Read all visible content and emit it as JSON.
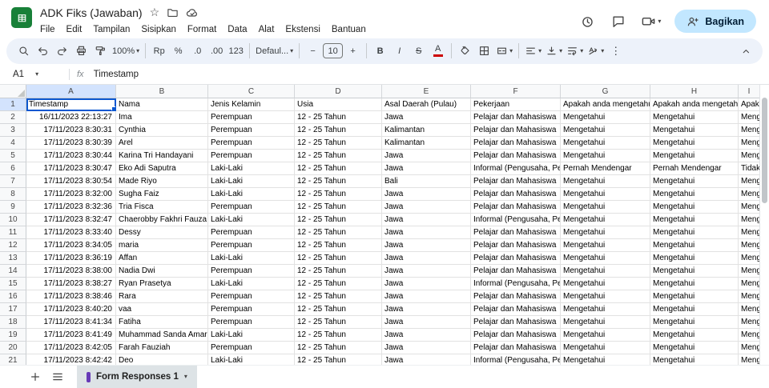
{
  "header": {
    "title": "ADK Fiks (Jawaban)",
    "menu_items": [
      "File",
      "Edit",
      "Tampilan",
      "Sisipkan",
      "Format",
      "Data",
      "Alat",
      "Ekstensi",
      "Bantuan"
    ],
    "share_label": "Bagikan"
  },
  "toolbar": {
    "zoom_value": "100%",
    "currency_label": "Rp",
    "percent_label": "%",
    "decimal_decrease_label": ".0",
    "decimal_increase_label": ".00",
    "number_format_label": "123",
    "font_name": "Defaul...",
    "font_size_value": "10",
    "bold_label": "B",
    "italic_label": "I",
    "strikethrough_label": "S",
    "text_color_label": "A",
    "more_label": "⋮"
  },
  "formula_bar": {
    "cell_reference": "A1",
    "fx_label": "fx",
    "value": "Timestamp"
  },
  "grid": {
    "column_letters": [
      "A",
      "B",
      "C",
      "D",
      "E",
      "F",
      "G",
      "H",
      "I"
    ],
    "header_row": [
      "Timestamp",
      "Nama",
      "Jenis Kelamin",
      "Usia",
      "Asal Daerah (Pulau)",
      "Pekerjaan",
      "Apakah anda mengetahu",
      "Apakah anda mengetahu",
      "Apakah"
    ],
    "data_rows": [
      [
        "16/11/2023 22:13:27",
        "Ima",
        "Perempuan",
        "12 - 25 Tahun",
        "Jawa",
        "Pelajar dan Mahasiswa",
        "Mengetahui",
        "Mengetahui",
        "Mengetahui"
      ],
      [
        "17/11/2023 8:30:31",
        "Cynthia",
        "Perempuan",
        "12 - 25 Tahun",
        "Kalimantan",
        "Pelajar dan Mahasiswa",
        "Mengetahui",
        "Mengetahui",
        "Mengetahui"
      ],
      [
        "17/11/2023 8:30:39",
        "Arel",
        "Perempuan",
        "12 - 25 Tahun",
        "Kalimantan",
        "Pelajar dan Mahasiswa",
        "Mengetahui",
        "Mengetahui",
        "Mengetahui"
      ],
      [
        "17/11/2023 8:30:44",
        "Karina Tri Handayani",
        "Perempuan",
        "12 - 25 Tahun",
        "Jawa",
        "Pelajar dan Mahasiswa",
        "Mengetahui",
        "Mengetahui",
        "Mengetahui"
      ],
      [
        "17/11/2023 8:30:47",
        "Eko Adi Saputra",
        "Laki-Laki",
        "12 - 25 Tahun",
        "Jawa",
        "Informal (Pengusaha, Pe",
        "Pernah Mendengar",
        "Pernah Mendengar",
        "Tidak M"
      ],
      [
        "17/11/2023 8:30:54",
        "Made Riyo",
        "Laki-Laki",
        "12 - 25 Tahun",
        "Bali",
        "Pelajar dan Mahasiswa",
        "Mengetahui",
        "Mengetahui",
        "Mengetahui"
      ],
      [
        "17/11/2023 8:32:00",
        "Sugha Faiz",
        "Laki-Laki",
        "12 - 25 Tahun",
        "Jawa",
        "Pelajar dan Mahasiswa",
        "Mengetahui",
        "Mengetahui",
        "Mengetahui"
      ],
      [
        "17/11/2023 8:32:36",
        "Tria Fisca",
        "Perempuan",
        "12 - 25 Tahun",
        "Jawa",
        "Pelajar dan Mahasiswa",
        "Mengetahui",
        "Mengetahui",
        "Mengetahui"
      ],
      [
        "17/11/2023 8:32:47",
        "Chaerobby Fakhri Fauza",
        "Laki-Laki",
        "12 - 25 Tahun",
        "Jawa",
        "Informal (Pengusaha, Pe",
        "Mengetahui",
        "Mengetahui",
        "Mengetahui"
      ],
      [
        "17/11/2023 8:33:40",
        "Dessy",
        "Perempuan",
        "12 - 25 Tahun",
        "Jawa",
        "Pelajar dan Mahasiswa",
        "Mengetahui",
        "Mengetahui",
        "Mengetahui"
      ],
      [
        "17/11/2023 8:34:05",
        "maria",
        "Perempuan",
        "12 - 25 Tahun",
        "Jawa",
        "Pelajar dan Mahasiswa",
        "Mengetahui",
        "Mengetahui",
        "Mengetahui"
      ],
      [
        "17/11/2023 8:36:19",
        "Affan",
        "Laki-Laki",
        "12 - 25 Tahun",
        "Jawa",
        "Pelajar dan Mahasiswa",
        "Mengetahui",
        "Mengetahui",
        "Mengetahui"
      ],
      [
        "17/11/2023 8:38:00",
        "Nadia Dwi",
        "Perempuan",
        "12 - 25 Tahun",
        "Jawa",
        "Pelajar dan Mahasiswa",
        "Mengetahui",
        "Mengetahui",
        "Mengetahui"
      ],
      [
        "17/11/2023 8:38:27",
        "Ryan Prasetya",
        "Laki-Laki",
        "12 - 25 Tahun",
        "Jawa",
        "Informal (Pengusaha, Pe",
        "Mengetahui",
        "Mengetahui",
        "Mengetahui"
      ],
      [
        "17/11/2023 8:38:46",
        "Rara",
        "Perempuan",
        "12 - 25 Tahun",
        "Jawa",
        "Pelajar dan Mahasiswa",
        "Mengetahui",
        "Mengetahui",
        "Mengetahui"
      ],
      [
        "17/11/2023 8:40:20",
        "vaa",
        "Perempuan",
        "12 - 25 Tahun",
        "Jawa",
        "Pelajar dan Mahasiswa",
        "Mengetahui",
        "Mengetahui",
        "Mengetahui"
      ],
      [
        "17/11/2023 8:41:34",
        "Fatiha",
        "Perempuan",
        "12 - 25 Tahun",
        "Jawa",
        "Pelajar dan Mahasiswa",
        "Mengetahui",
        "Mengetahui",
        "Mengetahui"
      ],
      [
        "17/11/2023 8:41:49",
        "Muhammad Sanda Amar",
        "Laki-Laki",
        "12 - 25 Tahun",
        "Jawa",
        "Pelajar dan Mahasiswa",
        "Mengetahui",
        "Mengetahui",
        "Mengetahui"
      ],
      [
        "17/11/2023 8:42:05",
        "Farah Fauziah",
        "Perempuan",
        "12 - 25 Tahun",
        "Jawa",
        "Pelajar dan Mahasiswa",
        "Mengetahui",
        "Mengetahui",
        "Mengetahui"
      ],
      [
        "17/11/2023 8:42:42",
        "Deo",
        "Laki-Laki",
        "12 - 25 Tahun",
        "Jawa",
        "Informal (Pengusaha, Pe",
        "Mengetahui",
        "Mengetahui",
        "Mengetahui"
      ]
    ]
  },
  "sheet_bar": {
    "active_tab_label": "Form Responses 1"
  },
  "icons": {
    "star": "☆",
    "caret_down": "▾",
    "more_vertical": "⋮",
    "minus": "−",
    "plus": "+"
  },
  "colors": {
    "accent_blue": "#0b57d0",
    "selected_header_bg": "#d3e3fd",
    "toolbar_bg": "#edf2fa",
    "share_button_bg": "#c2e7ff",
    "share_button_text": "#001d35",
    "logo_green": "#188038",
    "form_icon_purple": "#673ab7",
    "active_tab_bg": "#dde3e6"
  }
}
